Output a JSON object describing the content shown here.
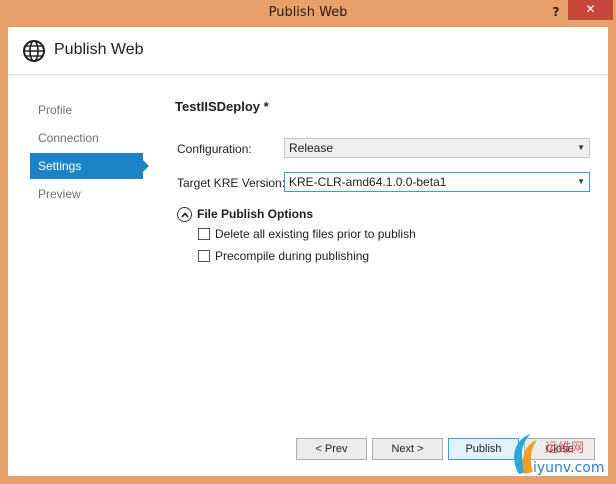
{
  "window": {
    "title": "Publish Web",
    "help_label": "?",
    "close_label": "✕"
  },
  "header": {
    "title": "Publish Web",
    "icon": "globe-icon"
  },
  "sidebar": {
    "items": [
      {
        "label": "Profile",
        "active": false
      },
      {
        "label": "Connection",
        "active": false
      },
      {
        "label": "Settings",
        "active": true
      },
      {
        "label": "Preview",
        "active": false
      }
    ]
  },
  "main": {
    "profile_name": "TestIISDeploy *",
    "configuration": {
      "label": "Configuration:",
      "value": "Release"
    },
    "kre_version": {
      "label": "Target KRE Version:",
      "value": "KRE-CLR-amd64.1.0.0-beta1"
    },
    "file_publish": {
      "title": "File Publish Options",
      "options": [
        {
          "label": "Delete all existing files prior to publish",
          "checked": false
        },
        {
          "label": "Precompile during publishing",
          "checked": false
        }
      ]
    }
  },
  "footer": {
    "prev_label": "< Prev",
    "next_label": "Next >",
    "publish_label": "Publish",
    "close_label": "Close"
  },
  "watermark": {
    "text": "运维网",
    "url_text": "iyunv.com"
  },
  "colors": {
    "titlebar": "#e8a06a",
    "accent": "#1c84c6",
    "close_button": "#c7463b"
  }
}
